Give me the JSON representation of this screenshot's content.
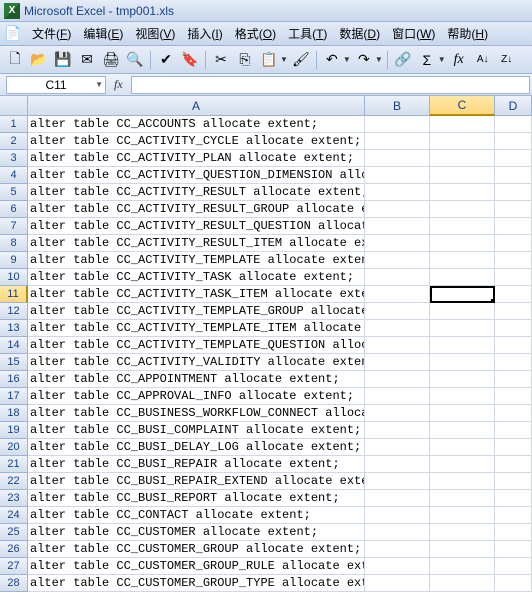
{
  "window": {
    "app_icon_letter": "X",
    "title": "Microsoft Excel - tmp001.xls"
  },
  "menu": {
    "items": [
      {
        "label": "文件(F)",
        "name": "menu-file"
      },
      {
        "label": "编辑(E)",
        "name": "menu-edit"
      },
      {
        "label": "视图(V)",
        "name": "menu-view"
      },
      {
        "label": "插入(I)",
        "name": "menu-insert"
      },
      {
        "label": "格式(O)",
        "name": "menu-format"
      },
      {
        "label": "工具(T)",
        "name": "menu-tools"
      },
      {
        "label": "数据(D)",
        "name": "menu-data"
      },
      {
        "label": "窗口(W)",
        "name": "menu-window"
      },
      {
        "label": "帮助(H)",
        "name": "menu-help"
      }
    ]
  },
  "toolbar": {
    "new": "🗋",
    "open": "📂",
    "save": "💾",
    "mail": "✉",
    "print": "🖨",
    "preview": "🔍",
    "spell": "✔",
    "cut": "✂",
    "copy": "⎘",
    "paste": "📋",
    "fmtpaint": "🖌",
    "undo": "↶",
    "redo": "↷",
    "link": "🔗",
    "sum": "Σ",
    "fx": "fx",
    "sortasc": "A↓",
    "sortdesc": "Z↓"
  },
  "namebox": {
    "value": "C11"
  },
  "fx_label": "fx",
  "columns": [
    "A",
    "B",
    "C",
    "D"
  ],
  "active_cell": {
    "row": 11,
    "col": "C"
  },
  "rows": [
    {
      "n": 1,
      "a": "alter table CC_ACCOUNTS allocate extent;"
    },
    {
      "n": 2,
      "a": "alter table CC_ACTIVITY_CYCLE allocate extent;"
    },
    {
      "n": 3,
      "a": "alter table CC_ACTIVITY_PLAN allocate extent;"
    },
    {
      "n": 4,
      "a": "alter table CC_ACTIVITY_QUESTION_DIMENSION allocate extent;"
    },
    {
      "n": 5,
      "a": "alter table CC_ACTIVITY_RESULT allocate extent;"
    },
    {
      "n": 6,
      "a": "alter table CC_ACTIVITY_RESULT_GROUP allocate extent;"
    },
    {
      "n": 7,
      "a": "alter table CC_ACTIVITY_RESULT_QUESTION allocate extent;"
    },
    {
      "n": 8,
      "a": "alter table CC_ACTIVITY_RESULT_ITEM allocate extent;"
    },
    {
      "n": 9,
      "a": "alter table CC_ACTIVITY_TEMPLATE allocate extent;"
    },
    {
      "n": 10,
      "a": "alter table CC_ACTIVITY_TASK allocate extent;"
    },
    {
      "n": 11,
      "a": "alter table CC_ACTIVITY_TASK_ITEM allocate extent;"
    },
    {
      "n": 12,
      "a": "alter table CC_ACTIVITY_TEMPLATE_GROUP allocate extent;"
    },
    {
      "n": 13,
      "a": "alter table CC_ACTIVITY_TEMPLATE_ITEM allocate extent;"
    },
    {
      "n": 14,
      "a": "alter table CC_ACTIVITY_TEMPLATE_QUESTION allocate extent;"
    },
    {
      "n": 15,
      "a": "alter table CC_ACTIVITY_VALIDITY allocate extent;"
    },
    {
      "n": 16,
      "a": "alter table CC_APPOINTMENT allocate extent;"
    },
    {
      "n": 17,
      "a": "alter table CC_APPROVAL_INFO allocate extent;"
    },
    {
      "n": 18,
      "a": "alter table CC_BUSINESS_WORKFLOW_CONNECT allocate extent;"
    },
    {
      "n": 19,
      "a": "alter table CC_BUSI_COMPLAINT allocate extent;"
    },
    {
      "n": 20,
      "a": "alter table CC_BUSI_DELAY_LOG allocate extent;"
    },
    {
      "n": 21,
      "a": "alter table CC_BUSI_REPAIR allocate extent;"
    },
    {
      "n": 22,
      "a": "alter table CC_BUSI_REPAIR_EXTEND allocate extent;"
    },
    {
      "n": 23,
      "a": "alter table CC_BUSI_REPORT allocate extent;"
    },
    {
      "n": 24,
      "a": "alter table CC_CONTACT allocate extent;"
    },
    {
      "n": 25,
      "a": "alter table CC_CUSTOMER allocate extent;"
    },
    {
      "n": 26,
      "a": "alter table CC_CUSTOMER_GROUP allocate extent;"
    },
    {
      "n": 27,
      "a": "alter table CC_CUSTOMER_GROUP_RULE allocate extent;"
    },
    {
      "n": 28,
      "a": "alter table CC_CUSTOMER_GROUP_TYPE allocate extent;"
    }
  ]
}
